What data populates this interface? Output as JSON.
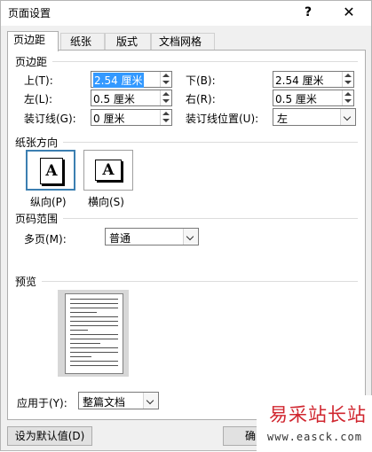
{
  "window": {
    "title": "页面设置",
    "help": "?",
    "close": "✕"
  },
  "tabs": [
    "页边距",
    "纸张",
    "版式",
    "文档网格"
  ],
  "margins": {
    "section": "页边距",
    "top_label": "上(T):",
    "top_value": "2.54 厘米",
    "bottom_label": "下(B):",
    "bottom_value": "2.54 厘米",
    "left_label": "左(L):",
    "left_value": "0.5 厘米",
    "right_label": "右(R):",
    "right_value": "0.5 厘米",
    "gutter_label": "装订线(G):",
    "gutter_value": "0 厘米",
    "gutter_pos_label": "装订线位置(U):",
    "gutter_pos_value": "左"
  },
  "orientation": {
    "section": "纸张方向",
    "icon_letter": "A",
    "portrait_label": "纵向(P)",
    "landscape_label": "横向(S)",
    "selected": "portrait"
  },
  "pages": {
    "section": "页码范围",
    "multiple_label": "多页(M):",
    "multiple_value": "普通"
  },
  "preview": {
    "section": "预览"
  },
  "apply": {
    "label": "应用于(Y):",
    "value": "整篇文档"
  },
  "buttons": {
    "set_default": "设为默认值(D)",
    "ok_partial": "确"
  },
  "watermark": {
    "title": "易采站长站",
    "url": "www.easck.com"
  },
  "colors": {
    "selection": "#3399ff",
    "accent_border": "#3c7fb1",
    "watermark": "#d0262f"
  }
}
